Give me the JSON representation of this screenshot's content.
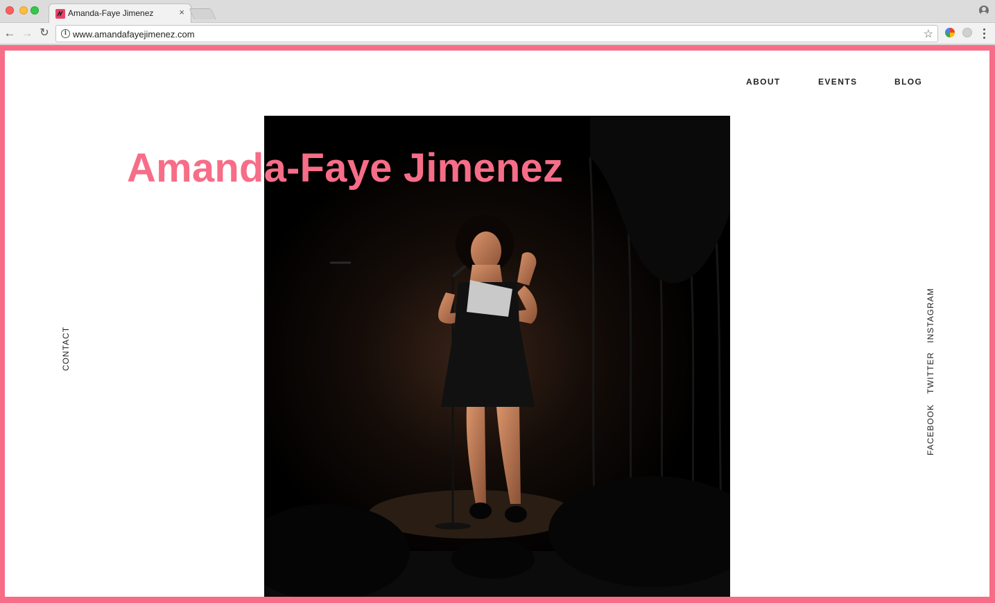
{
  "browser": {
    "tab_title": "Amanda-Faye Jimenez",
    "tab_close": "×",
    "url": "www.amandafayejimenez.com",
    "info_glyph": "i",
    "star_glyph": "☆",
    "back_glyph": "←",
    "forward_glyph": "→",
    "reload_glyph": "↻"
  },
  "site": {
    "title": "Amanda-Faye Jimenez",
    "accent_color": "#f76d87",
    "nav": [
      {
        "label": "ABOUT"
      },
      {
        "label": "EVENTS"
      },
      {
        "label": "BLOG"
      }
    ],
    "contact_label": "CONTACT",
    "social": [
      {
        "label": "INSTAGRAM"
      },
      {
        "label": "TWITTER"
      },
      {
        "label": "FACEBOOK"
      }
    ],
    "hero_image": "performer-on-stage-photo"
  }
}
